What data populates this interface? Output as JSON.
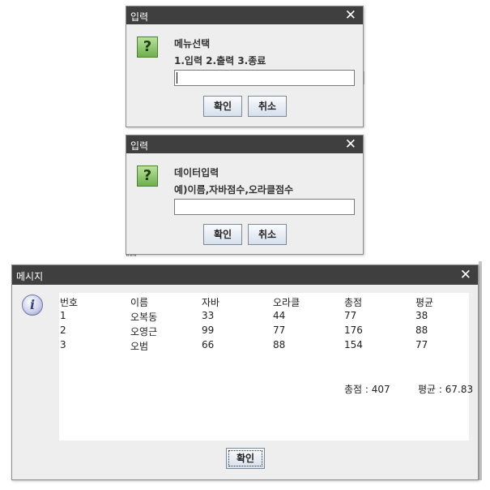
{
  "dialog1": {
    "title": "입력",
    "close": "✕",
    "message_line1": "메뉴선택",
    "message_line2": "1.입력 2.출력 3.종료",
    "input_value": "",
    "ok": "확인",
    "cancel": "취소"
  },
  "dialog2": {
    "title": "입력",
    "close": "✕",
    "message_line1": "데이터입력",
    "message_line2": "예)이름,자바점수,오라클점수",
    "input_value": "",
    "ok": "확인",
    "cancel": "취소"
  },
  "message_dialog": {
    "title": "메시지",
    "close": "✕",
    "table": {
      "headers": [
        "번호",
        "이름",
        "자바",
        "오라클",
        "총점",
        "평균"
      ],
      "rows": [
        [
          "1",
          "오복동",
          "33",
          "44",
          "77",
          "38"
        ],
        [
          "2",
          "오영근",
          "99",
          "77",
          "176",
          "88"
        ],
        [
          "3",
          "오범",
          "66",
          "88",
          "154",
          "77"
        ]
      ]
    },
    "summary_total": "총점 : 407",
    "summary_average": "평균 : 67.83",
    "ok": "확인"
  },
  "background": {
    "fragment1": "\"\"\"",
    "fragment2": "\"\"\""
  },
  "colors": {
    "titlebar": "#3f3f3f",
    "dialog_bg": "#eeeeee",
    "question_icon": "#6fae4e",
    "info_icon": "#8d94c8"
  }
}
